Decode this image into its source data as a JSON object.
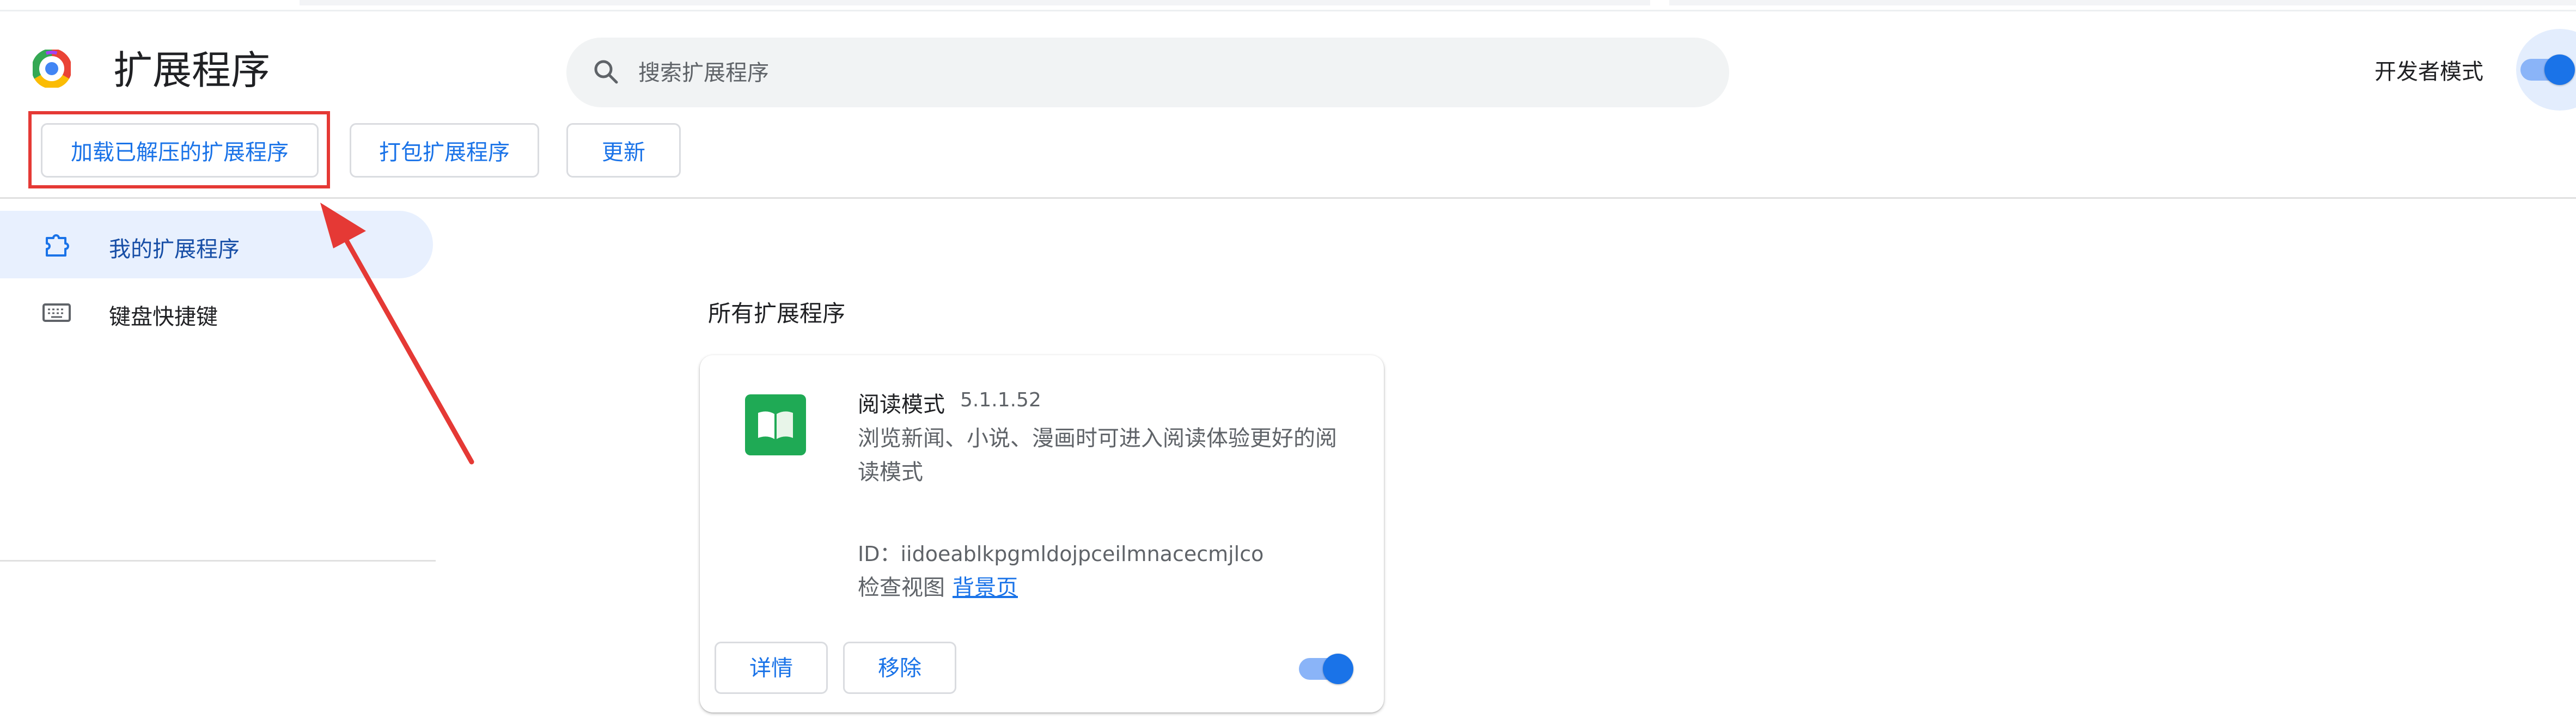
{
  "header": {
    "title": "扩展程序",
    "search_placeholder": "搜索扩展程序",
    "developer_mode_label": "开发者模式",
    "developer_mode_on": true
  },
  "toolbar": {
    "load_unpacked_label": "加载已解压的扩展程序",
    "pack_label": "打包扩展程序",
    "update_label": "更新"
  },
  "sidebar": {
    "items": [
      {
        "label": "我的扩展程序",
        "icon": "extension-icon",
        "active": true
      },
      {
        "label": "键盘快捷键",
        "icon": "keyboard-icon",
        "active": false
      }
    ]
  },
  "main": {
    "section_title": "所有扩展程序",
    "extension": {
      "name": "阅读模式",
      "version": "5.1.1.52",
      "description": "浏览新闻、小说、漫画时可进入阅读体验更好的阅读模式",
      "id_line": "ID：iidoeablkpgmldojpceilmnacecmjlco",
      "inspect_views_label": "检查视图",
      "background_page_link": "背景页",
      "details_label": "详情",
      "remove_label": "移除",
      "enabled": true
    }
  },
  "colors": {
    "accent": "#1a73e8",
    "highlight_box": "#e53935",
    "extension_icon_bg": "#1faa55"
  }
}
